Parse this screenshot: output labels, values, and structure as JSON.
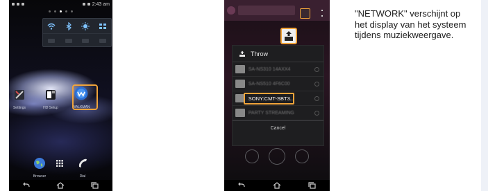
{
  "phone1": {
    "status_time": "2:43 am",
    "apps": [
      {
        "label": "Settings",
        "icon": "settings-icon"
      },
      {
        "label": "HD Setup",
        "icon": "hd-setup-icon"
      },
      {
        "label": "WALKMAN",
        "icon": "walkman-icon"
      }
    ],
    "dock": [
      {
        "label": "Browser",
        "icon": "globe-icon"
      },
      {
        "label": "",
        "icon": "apps-grid-icon"
      },
      {
        "label": "Dial",
        "icon": "phone-icon"
      }
    ]
  },
  "phone2": {
    "dialog_title": "Throw",
    "devices": [
      {
        "name": "SA-NS310 14AXX4",
        "selected": false
      },
      {
        "name": "SA-NS510 4F6C00",
        "selected": false
      },
      {
        "name": "SONY:CMT-SBT3...",
        "selected": true
      },
      {
        "name": "PARTY STREAMING",
        "selected": false
      }
    ],
    "cancel_label": "Cancel"
  },
  "caption": "\"NETWORK\" verschijnt op het display van het systeem tijdens muziekweergave.",
  "colors": {
    "highlight": "#f1a43a"
  }
}
